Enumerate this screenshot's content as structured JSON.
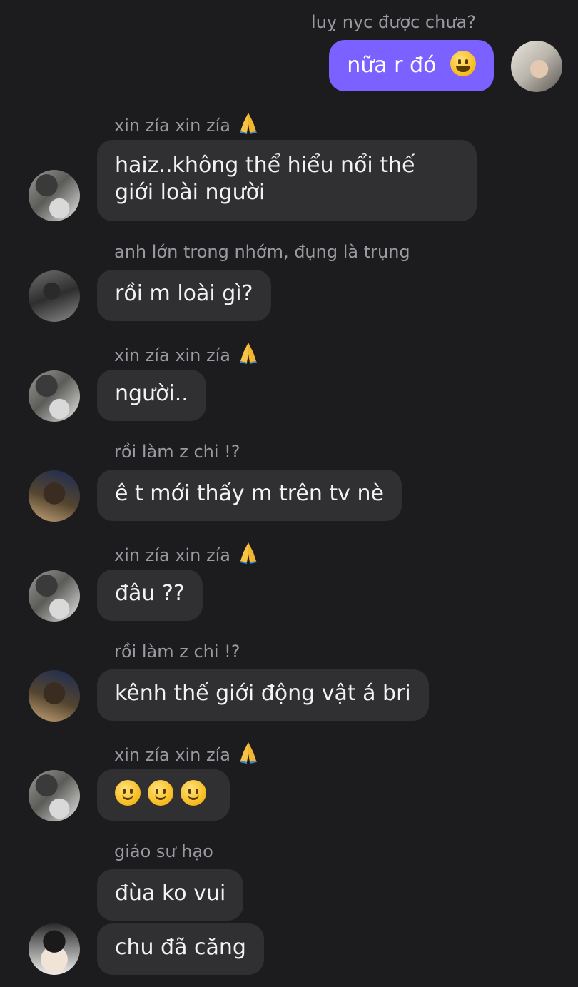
{
  "messages": [
    {
      "sender": "luỵ nyc được chưa?",
      "text": "nữa r đó",
      "emoji": "grinning-face-emoji",
      "mine": true
    },
    {
      "sender": "xin zía xin zía",
      "sender_icon": "folded-hands-emoji",
      "text": "haiz..không thể hiểu nổi thế giới loài người"
    },
    {
      "sender": "anh lớn trong nhớm, đụng là trụng",
      "text": "rồi m loài gì?"
    },
    {
      "sender": "xin zía xin zía",
      "sender_icon": "folded-hands-emoji",
      "text": "người.."
    },
    {
      "sender": "rồi làm z chi !?",
      "text": "ê t mới thấy m trên tv nè"
    },
    {
      "sender": "xin zía xin zía",
      "sender_icon": "folded-hands-emoji",
      "text": "đâu ??"
    },
    {
      "sender": "rồi làm z chi !?",
      "text": "kênh thế giới động vật á bri"
    },
    {
      "sender": "xin zía xin zía",
      "sender_icon": "folded-hands-emoji",
      "emoji": [
        "slightly-smiling-face-emoji",
        "slightly-smiling-face-emoji",
        "slightly-smiling-face-emoji"
      ]
    },
    {
      "sender": "giáo sư hạo",
      "text": "đùa ko vui"
    },
    {
      "text": "chu đã căng"
    }
  ],
  "colors": {
    "background": "#1c1c1e",
    "incoming_bubble": "#303033",
    "outgoing_bubble": "#7b61ff",
    "sender_text": "#9a9aa0",
    "message_text": "#f2f2f5"
  }
}
